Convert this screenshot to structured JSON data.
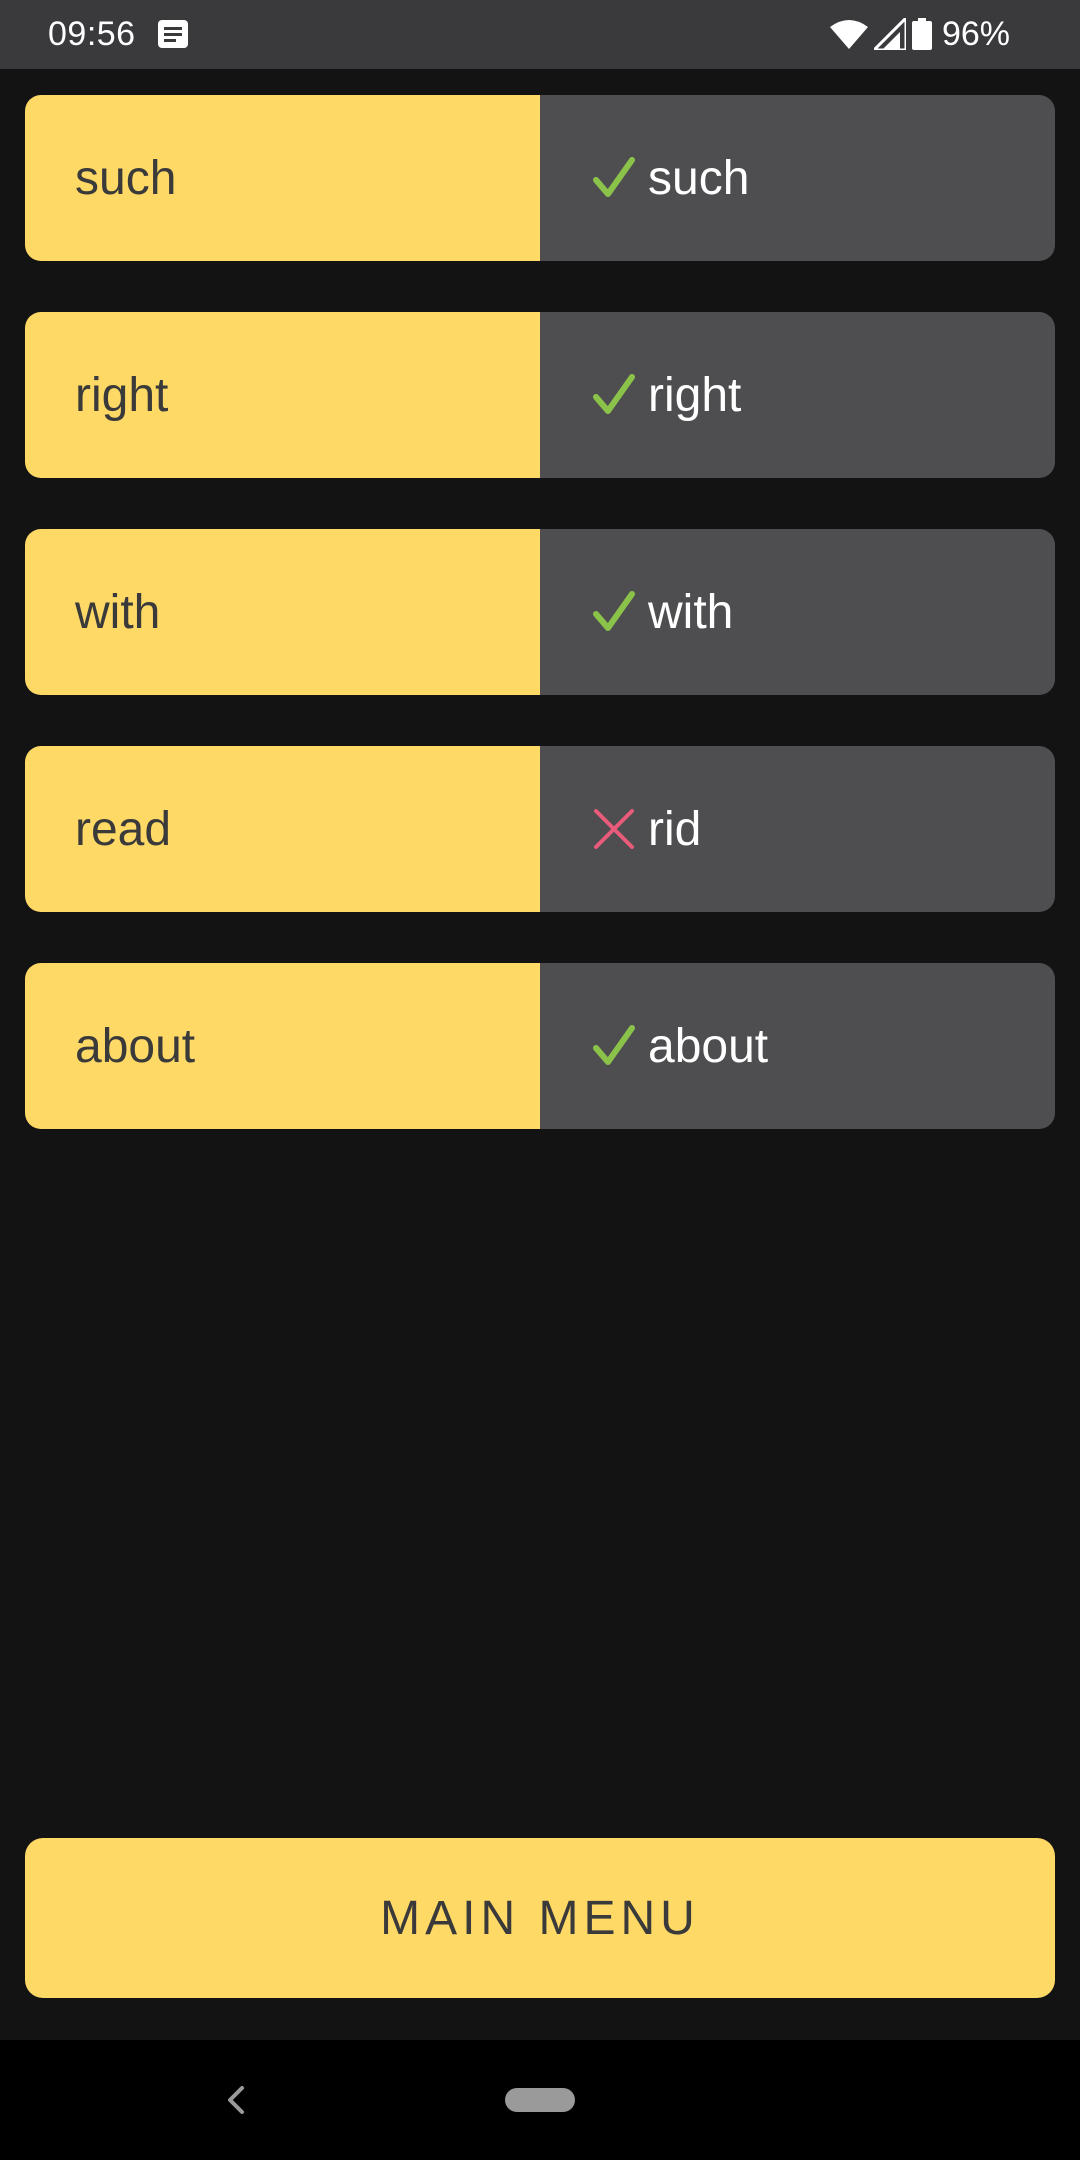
{
  "status_bar": {
    "time": "09:56",
    "battery": "96%",
    "icons": [
      "notification-icon",
      "wifi-icon",
      "signal-icon",
      "battery-icon"
    ]
  },
  "rows": [
    {
      "target": "such",
      "answer": "such",
      "correct": true
    },
    {
      "target": "right",
      "answer": "right",
      "correct": true
    },
    {
      "target": "with",
      "answer": "with",
      "correct": true
    },
    {
      "target": "read",
      "answer": "rid",
      "correct": false
    },
    {
      "target": "about",
      "answer": "about",
      "correct": true
    }
  ],
  "main_menu_label": "MAIN MENU",
  "colors": {
    "accent": "#ffd966",
    "correct": "#8bc34a",
    "incorrect": "#e85b7a",
    "panel": "#4e4d50",
    "background": "#131313"
  },
  "nav": {
    "icons": [
      "back-icon",
      "home-pill"
    ]
  }
}
